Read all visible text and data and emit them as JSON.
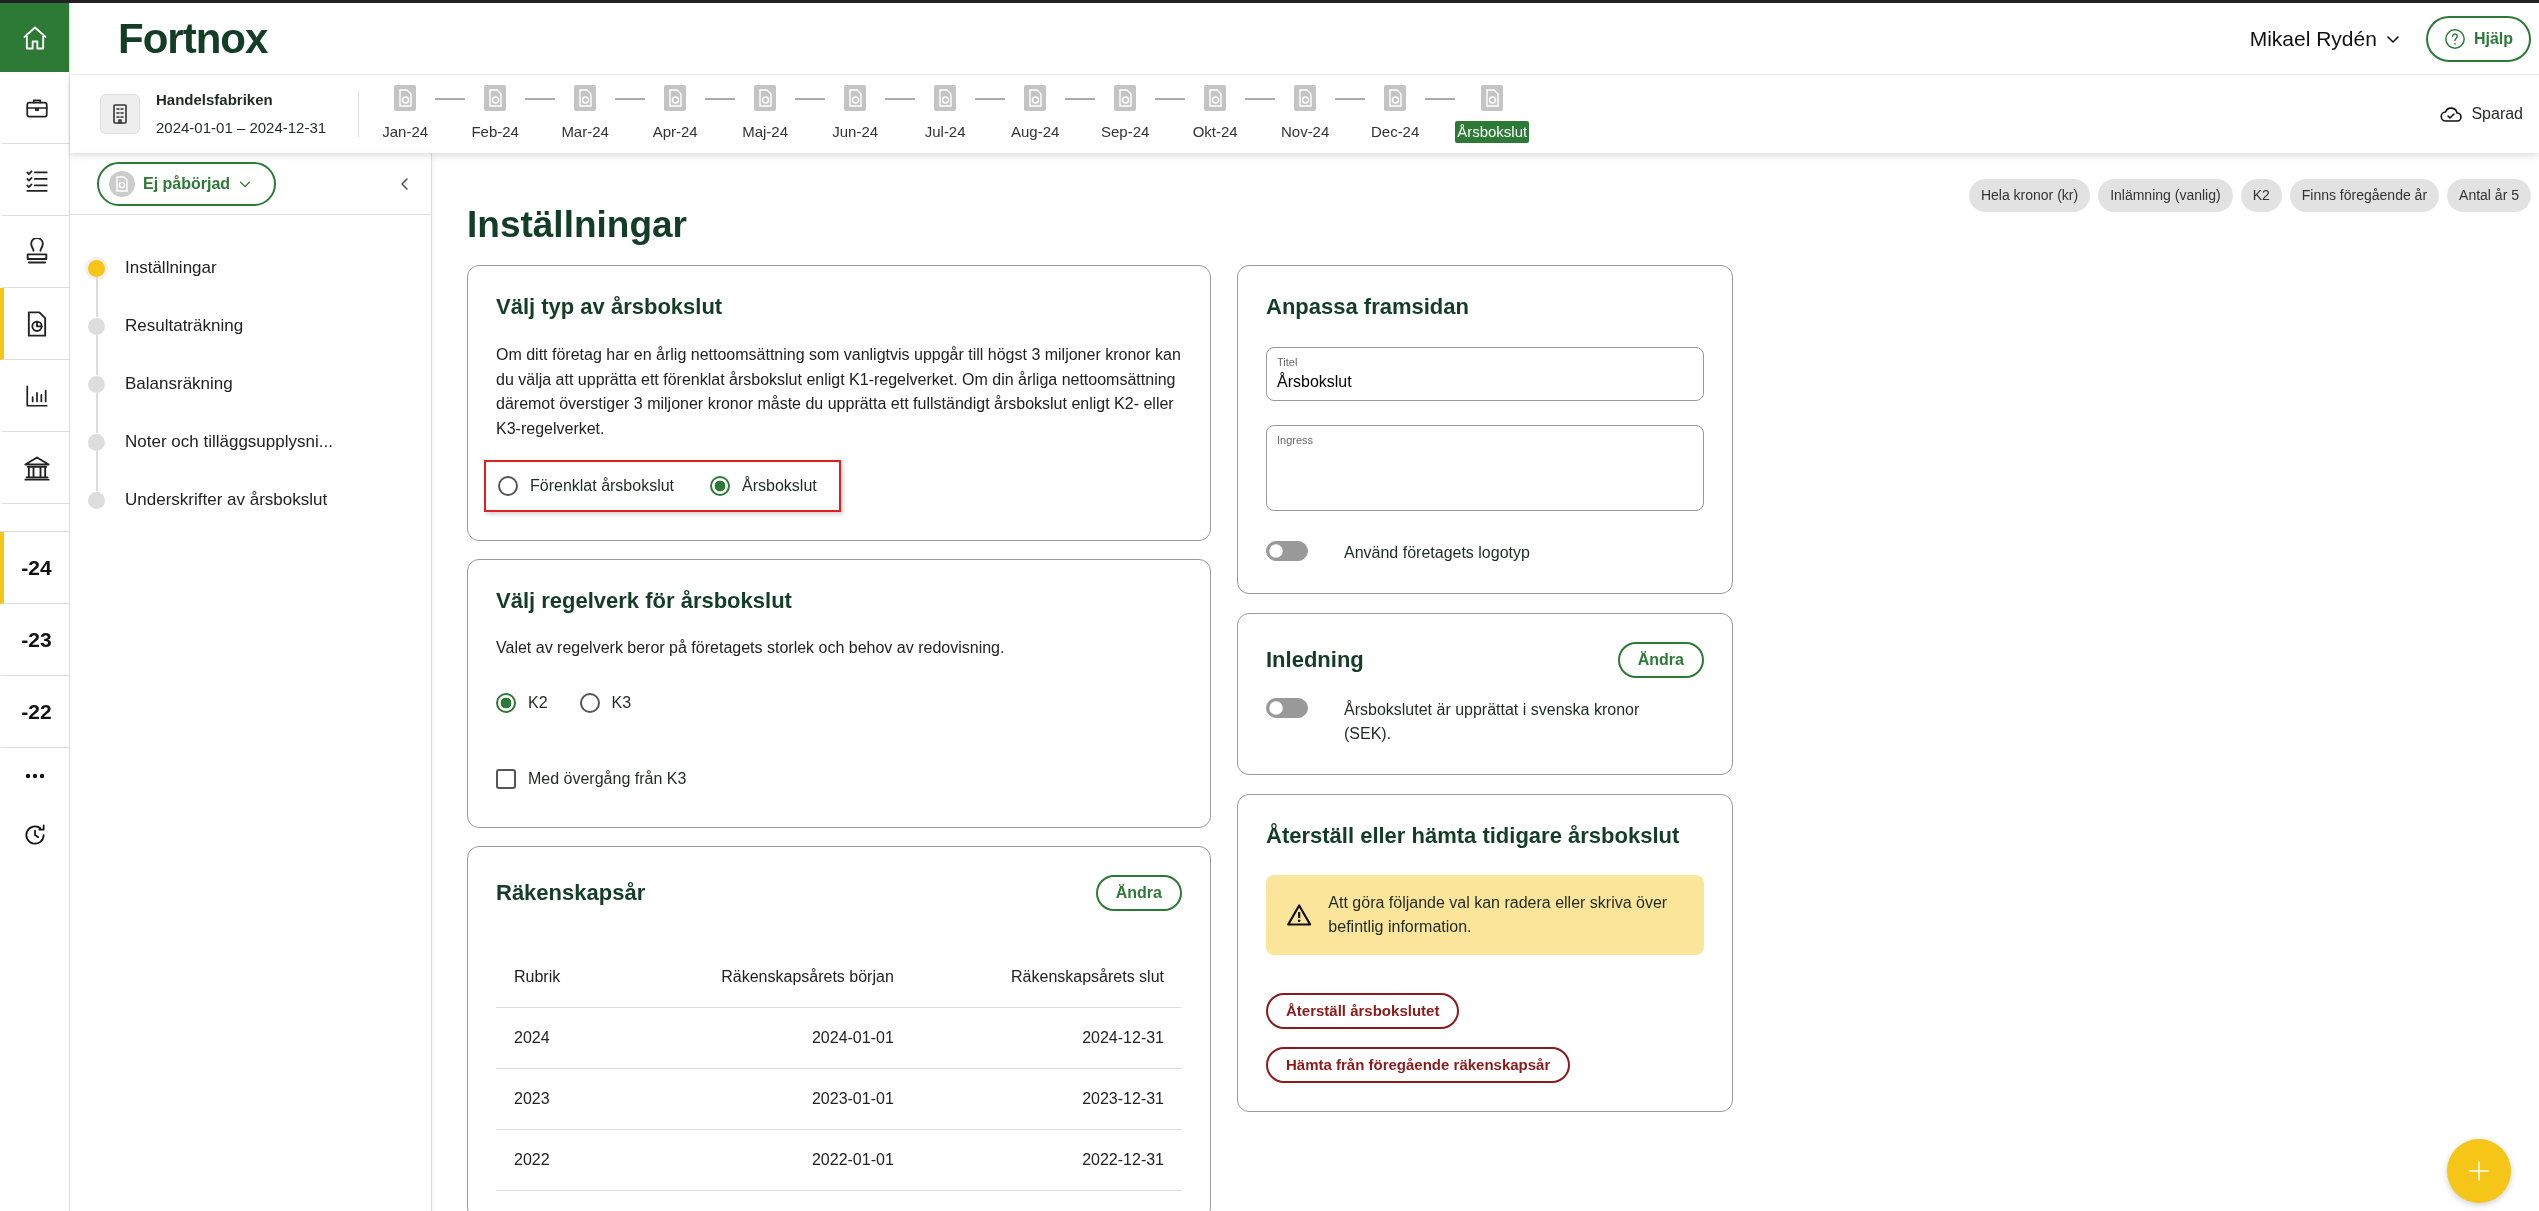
{
  "header": {
    "logo": "Fortnox",
    "user": "Mikael Rydén",
    "help_button": "Hjälp"
  },
  "rail": {
    "nav_items": [
      {
        "selected": false
      },
      {
        "selected": false
      },
      {
        "selected": false
      },
      {
        "selected": true
      },
      {
        "selected": false
      },
      {
        "selected": false
      }
    ],
    "years": [
      {
        "label": "-24",
        "selected": true
      },
      {
        "label": "-23",
        "selected": false
      },
      {
        "label": "-22",
        "selected": false
      }
    ]
  },
  "subheader": {
    "company": "Handelsfabriken",
    "period": "2024-01-01 – 2024-12-31",
    "save_status": "Sparad",
    "periods": [
      {
        "label": "Jan-24",
        "selected": false
      },
      {
        "label": "Feb-24",
        "selected": false
      },
      {
        "label": "Mar-24",
        "selected": false
      },
      {
        "label": "Apr-24",
        "selected": false
      },
      {
        "label": "Maj-24",
        "selected": false
      },
      {
        "label": "Jun-24",
        "selected": false
      },
      {
        "label": "Jul-24",
        "selected": false
      },
      {
        "label": "Aug-24",
        "selected": false
      },
      {
        "label": "Sep-24",
        "selected": false
      },
      {
        "label": "Okt-24",
        "selected": false
      },
      {
        "label": "Nov-24",
        "selected": false
      },
      {
        "label": "Dec-24",
        "selected": false
      },
      {
        "label": "Årsbokslut",
        "selected": true
      }
    ]
  },
  "sidebar": {
    "status_button": "Ej påbörjad",
    "steps": [
      {
        "label": "Inställningar",
        "selected": true
      },
      {
        "label": "Resultaträkning",
        "selected": false
      },
      {
        "label": "Balansräkning",
        "selected": false
      },
      {
        "label": "Noter och tilläggsupplysni...",
        "selected": false
      },
      {
        "label": "Underskrifter av årsbokslut",
        "selected": false
      }
    ]
  },
  "tags": [
    "Hela kronor (kr)",
    "Inlämning (vanlig)",
    "K2",
    "Finns föregående år",
    "Antal år 5"
  ],
  "page_title": "Inställningar",
  "type_card": {
    "title": "Välj typ av årsbokslut",
    "description": "Om ditt företag har en årlig nettoomsättning som vanligtvis uppgår till högst 3 miljoner kronor kan du välja att upprätta ett förenklat årsbokslut enligt K1-regelverket. Om din årliga nettoomsättning däremot överstiger 3 miljoner kronor måste du upprätta ett fullständigt årsbokslut enligt K2- eller K3-regelverket.",
    "highlighted": true,
    "options": [
      {
        "label": "Förenklat årsbokslut",
        "selected": false
      },
      {
        "label": "Årsbokslut",
        "selected": true
      }
    ]
  },
  "framework_card": {
    "title": "Välj regelverk för årsbokslut",
    "description": "Valet av regelverk beror på företagets storlek och behov av redovisning.",
    "options": [
      {
        "label": "K2",
        "selected": true
      },
      {
        "label": "K3",
        "selected": false
      }
    ],
    "checkbox": {
      "label": "Med övergång från K3",
      "checked": false
    }
  },
  "fiscal_card": {
    "title": "Räkenskapsår",
    "edit_button": "Ändra",
    "columns": [
      "Rubrik",
      "Räkenskapsårets början",
      "Räkenskapsårets slut"
    ],
    "rows": [
      [
        "2024",
        "2024-01-01",
        "2024-12-31"
      ],
      [
        "2023",
        "2023-01-01",
        "2023-12-31"
      ],
      [
        "2022",
        "2022-01-01",
        "2022-12-31"
      ]
    ]
  },
  "cover_card": {
    "title": "Anpassa framsidan",
    "fields": [
      {
        "kind": "input",
        "label": "Titel",
        "value": "Årsbokslut"
      },
      {
        "kind": "textarea",
        "label": "Ingress"
      }
    ],
    "toggle": {
      "label": "Använd företagets logotyp",
      "on": false
    }
  },
  "intro_card": {
    "title": "Inledning",
    "edit_button": "Ändra",
    "toggle": {
      "label": "Årsbokslutet är upprättat i svenska kronor (SEK).",
      "on": false
    }
  },
  "restore_card": {
    "title": "Återställ eller hämta tidigare årsbokslut",
    "warning": "Att göra följande val kan radera eller skriva över befintlig information.",
    "buttons": [
      "Återställ årsbokslutet",
      "Hämta från föregående räkenskapsår"
    ]
  }
}
